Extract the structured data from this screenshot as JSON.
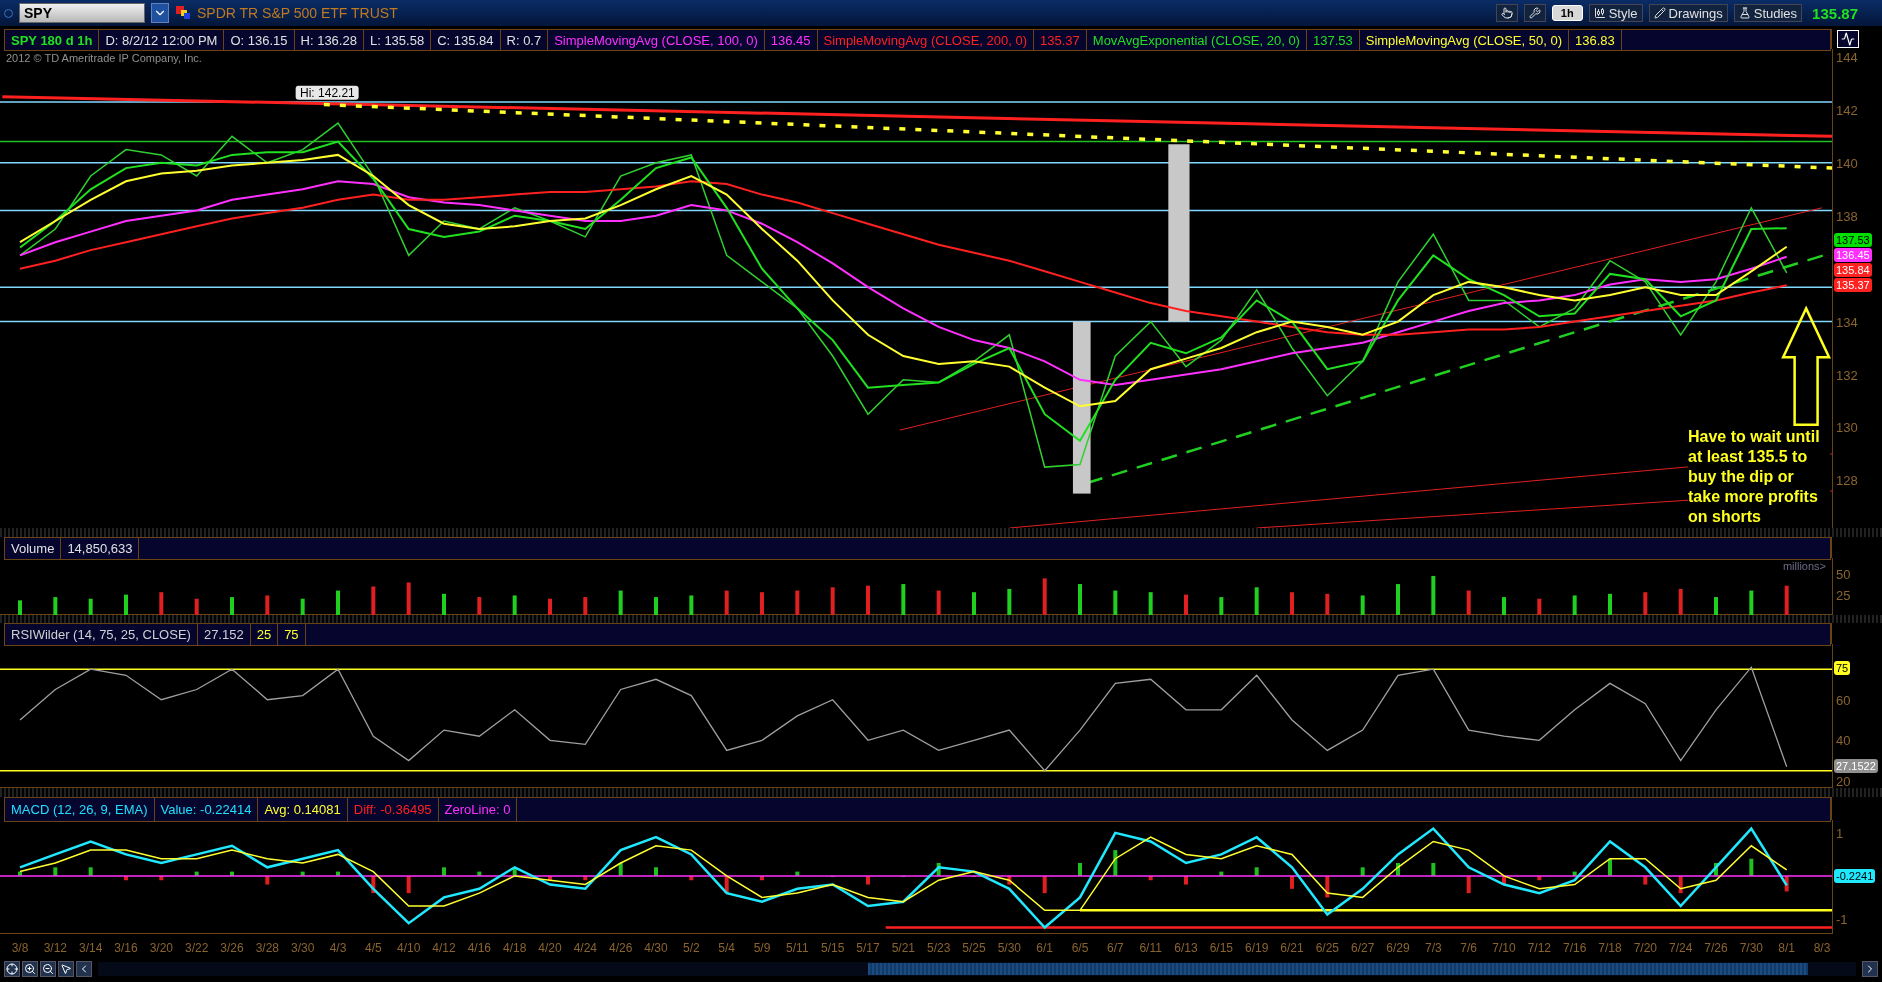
{
  "toolbar": {
    "symbol": "SPY",
    "description": "SPDR TR S&P 500 ETF TRUST",
    "interval": "1h",
    "buttons": [
      {
        "kind": "style",
        "label": "Style"
      },
      {
        "kind": "drawings",
        "label": "Drawings"
      },
      {
        "kind": "studies",
        "label": "Studies"
      }
    ],
    "last_price": "135.87"
  },
  "info_bar": [
    {
      "kind": "symbol",
      "text": "SPY 180 d 1h"
    },
    {
      "kind": "field",
      "text": "D: 8/2/12 12:00 PM"
    },
    {
      "kind": "field",
      "text": "O: 136.15"
    },
    {
      "kind": "field",
      "text": "H: 136.28"
    },
    {
      "kind": "field",
      "text": "L: 135.58"
    },
    {
      "kind": "field",
      "text": "C: 135.84"
    },
    {
      "kind": "field",
      "text": "R: 0.7"
    }
  ],
  "study_values": [
    "136.45",
    "135.37",
    "137.53",
    "136.83"
  ],
  "copyright": "2012 © TD Ameritrade IP Company, Inc.",
  "price_badges": [
    {
      "text": "137.53",
      "color": "#00e000"
    },
    {
      "text": "136.45",
      "color": "#ff30ff"
    },
    {
      "text": "135.84",
      "color": "#ff2020"
    },
    {
      "text": "135.37",
      "color": "#ff2020"
    }
  ],
  "chart": {
    "chart_data": {
      "type": "line",
      "ylim": [
        126.2,
        144.3
      ],
      "yticks": [
        128,
        130,
        132,
        134,
        138,
        140,
        142,
        144
      ],
      "series": [
        {
          "color": "#30d030",
          "values": [
            136.5,
            137.5,
            139.5,
            140.5,
            140.3,
            139.5,
            141,
            140,
            140.5,
            141.5,
            139.5,
            136.5,
            137.8,
            137.5,
            138.3,
            137.8,
            137.2,
            139.5,
            140,
            140.3,
            136.5,
            135.5,
            134.5,
            132.7,
            130.5,
            131.8,
            131.7,
            132.5,
            133.5,
            128.5,
            128.6,
            132.7,
            134,
            132.3,
            133.3,
            135.2,
            133,
            131.2,
            132.5,
            135.5,
            137.3,
            134.8,
            134.8,
            133.8,
            134.5,
            136.3,
            135.5,
            133.5,
            135.5,
            138.3,
            135.84,
            null
          ]
        },
        {
          "name": "SimpleMovingAvg (CLOSE, 100, 0)",
          "color": "#ff30ff",
          "values": [
            136.5,
            137.0,
            137.4,
            137.8,
            138.0,
            138.2,
            138.6,
            138.8,
            139.0,
            139.3,
            139.2,
            138.7,
            138.5,
            138.4,
            138.2,
            138.0,
            137.8,
            137.8,
            138.0,
            138.4,
            138.2,
            137.7,
            137.0,
            136.2,
            135.3,
            134.5,
            133.8,
            133.3,
            133.0,
            132.5,
            131.8,
            131.6,
            131.8,
            132.0,
            132.2,
            132.5,
            132.8,
            133.0,
            133.2,
            133.6,
            134.0,
            134.4,
            134.7,
            134.8,
            135.0,
            135.4,
            135.6,
            135.5,
            135.6,
            136.0,
            136.45,
            null
          ]
        },
        {
          "name": "SimpleMovingAvg (CLOSE, 200, 0)",
          "color": "#ff2020",
          "values": [
            136.0,
            136.3,
            136.7,
            137.0,
            137.3,
            137.6,
            137.9,
            138.1,
            138.3,
            138.6,
            138.8,
            138.6,
            138.6,
            138.7,
            138.8,
            138.9,
            138.9,
            139.0,
            139.1,
            139.3,
            139.2,
            138.8,
            138.5,
            138.1,
            137.7,
            137.3,
            136.9,
            136.6,
            136.3,
            135.9,
            135.5,
            135.1,
            134.7,
            134.4,
            134.2,
            134.0,
            133.8,
            133.6,
            133.5,
            133.5,
            133.6,
            133.7,
            133.7,
            133.8,
            134.0,
            134.2,
            134.4,
            134.6,
            134.8,
            135.1,
            135.37,
            null
          ]
        },
        {
          "name": "MovAvgExponential (CLOSE, 20, 0)",
          "color": "#20e020",
          "values": [
            136.8,
            137.8,
            139.0,
            139.8,
            140.0,
            139.9,
            140.3,
            140.4,
            140.4,
            140.8,
            139.4,
            137.5,
            137.2,
            137.4,
            138.0,
            137.8,
            137.5,
            138.6,
            139.8,
            140.2,
            138.3,
            136.0,
            134.5,
            133.3,
            131.5,
            131.6,
            131.7,
            132.4,
            133.0,
            130.5,
            129.5,
            131.8,
            133.2,
            132.8,
            133.4,
            134.8,
            134.0,
            132.2,
            132.5,
            134.8,
            136.5,
            135.6,
            135.0,
            134.2,
            134.3,
            135.8,
            135.6,
            134.2,
            134.8,
            137.5,
            137.53,
            null
          ]
        },
        {
          "name": "SimpleMovingAvg (CLOSE, 50, 0)",
          "color": "#ffff30",
          "values": [
            137.0,
            137.8,
            138.6,
            139.3,
            139.6,
            139.7,
            139.9,
            140.0,
            140.1,
            140.3,
            139.5,
            138.4,
            137.7,
            137.5,
            137.6,
            137.8,
            137.9,
            138.4,
            139.0,
            139.5,
            138.8,
            137.5,
            136.3,
            134.8,
            133.5,
            132.7,
            132.4,
            132.5,
            132.3,
            131.5,
            130.8,
            131.0,
            132.2,
            132.6,
            133.0,
            133.6,
            134.0,
            133.8,
            133.5,
            134.0,
            135.0,
            135.5,
            135.3,
            135.0,
            134.8,
            135.0,
            135.3,
            135.0,
            135.0,
            135.9,
            136.83,
            null
          ]
        }
      ]
    },
    "high_label": "Hi: 142.21",
    "note": "Have to wait until at least 135.5 to buy the dip or take more profits on shorts"
  },
  "volume": {
    "header": [
      {
        "text": "Volume"
      },
      {
        "text": "14,850,633"
      }
    ],
    "unit_label": "millions>",
    "chart_data": {
      "type": "bar",
      "ylim": [
        0,
        70
      ],
      "yticks": [
        25,
        50
      ],
      "values": [
        18,
        22,
        20,
        25,
        28,
        20,
        22,
        24,
        20,
        30,
        35,
        40,
        26,
        22,
        24,
        20,
        22,
        30,
        22,
        24,
        30,
        28,
        30,
        34,
        36,
        38,
        30,
        28,
        32,
        45,
        38,
        30,
        28,
        25,
        22,
        34,
        28,
        26,
        24,
        38,
        48,
        30,
        22,
        20,
        24,
        26,
        28,
        32,
        22,
        30,
        36,
        null
      ]
    }
  },
  "rsi": {
    "header": [
      {
        "kind": "reading",
        "text": "27.152"
      },
      {
        "kind": "level",
        "text": "25"
      },
      {
        "kind": "level",
        "text": "75"
      }
    ],
    "badges": [
      {
        "text": "75",
        "color": "#ffff20"
      },
      {
        "text": "27.1522",
        "color": "#909090"
      }
    ],
    "chart_data": {
      "type": "line",
      "ylim": [
        16.5,
        87.4
      ],
      "yticks": [
        20,
        40,
        60
      ],
      "series": [
        {
          "name": "RSIWilder (14, 75, 25, CLOSE)",
          "color": "#a0a0a0",
          "values": [
            50,
            65,
            75,
            72,
            60,
            65,
            75,
            60,
            62,
            75,
            42,
            30,
            45,
            42,
            55,
            40,
            38,
            65,
            70,
            62,
            35,
            40,
            52,
            60,
            40,
            45,
            35,
            40,
            45,
            25,
            45,
            68,
            70,
            55,
            55,
            72,
            50,
            35,
            45,
            72,
            75,
            45,
            42,
            40,
            55,
            68,
            58,
            30,
            55,
            76,
            27,
            null
          ]
        }
      ]
    }
  },
  "macd": {
    "header": [
      {
        "kind": "value",
        "text": "MACD (12, 26, 9, EMA)"
      },
      {
        "kind": "value",
        "text": "Value: -0.22414"
      },
      {
        "kind": "avg",
        "text": "Avg: 0.14081"
      },
      {
        "kind": "diff",
        "text": "Diff: -0.36495"
      },
      {
        "kind": "zeroline",
        "text": "ZeroLine: 0"
      }
    ],
    "badges": [
      {
        "text": "-0.2241",
        "color": "#20e8ff"
      }
    ],
    "chart_data": {
      "type": "line",
      "categories": [
        "3/8",
        "3/12",
        "3/14",
        "3/16",
        "3/20",
        "3/22",
        "3/26",
        "3/28",
        "3/30",
        "4/3",
        "4/5",
        "4/10",
        "4/12",
        "4/16",
        "4/18",
        "4/20",
        "4/24",
        "4/26",
        "4/30",
        "5/2",
        "5/4",
        "5/9",
        "5/11",
        "5/15",
        "5/17",
        "5/21",
        "5/23",
        "5/25",
        "5/30",
        "6/1",
        "6/5",
        "6/7",
        "6/11",
        "6/13",
        "6/15",
        "6/19",
        "6/21",
        "6/25",
        "6/27",
        "6/29",
        "7/3",
        "7/6",
        "7/10",
        "7/12",
        "7/16",
        "7/18",
        "7/20",
        "7/24",
        "7/26",
        "7/30",
        "8/1",
        "8/3"
      ],
      "ylim": [
        -1.35,
        1.3
      ],
      "yticks": [
        -1,
        1
      ],
      "series": [
        {
          "color": "#20e8ff",
          "values": [
            0.2,
            0.5,
            0.8,
            0.5,
            0.3,
            0.5,
            0.7,
            0.2,
            0.4,
            0.6,
            -0.3,
            -1.1,
            -0.5,
            -0.3,
            0.2,
            -0.2,
            -0.3,
            0.6,
            0.9,
            0.5,
            -0.4,
            -0.6,
            -0.3,
            -0.2,
            -0.7,
            -0.6,
            0.2,
            0.1,
            -0.3,
            -1.2,
            -0.5,
            1.0,
            0.8,
            0.3,
            0.5,
            0.9,
            0.2,
            -0.9,
            -0.3,
            0.5,
            1.1,
            0.2,
            -0.2,
            -0.4,
            -0.1,
            0.8,
            0.2,
            -0.7,
            0.2,
            1.1,
            -0.22,
            null
          ]
        },
        {
          "color": "#ffff30",
          "values": [
            0.1,
            0.3,
            0.6,
            0.6,
            0.4,
            0.4,
            0.6,
            0.4,
            0.3,
            0.5,
            0.1,
            -0.7,
            -0.7,
            -0.4,
            0.0,
            -0.1,
            -0.2,
            0.3,
            0.7,
            0.6,
            0.0,
            -0.5,
            -0.4,
            -0.2,
            -0.5,
            -0.6,
            -0.1,
            0.1,
            -0.1,
            -0.8,
            -0.8,
            0.4,
            0.9,
            0.5,
            0.4,
            0.7,
            0.5,
            -0.4,
            -0.5,
            0.2,
            0.8,
            0.6,
            0.0,
            -0.3,
            -0.2,
            0.4,
            0.4,
            -0.3,
            -0.1,
            0.7,
            0.14,
            null
          ]
        }
      ]
    }
  }
}
